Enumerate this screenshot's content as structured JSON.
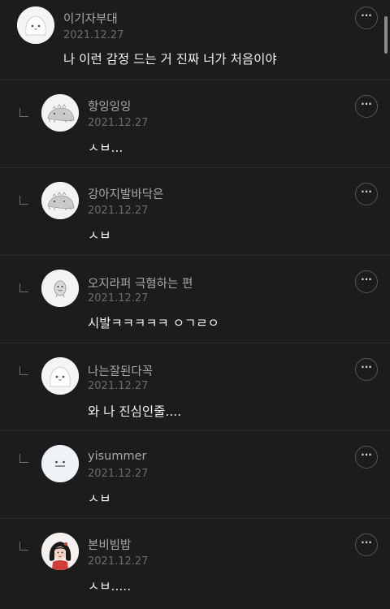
{
  "comments": [
    {
      "author": "이기자부대",
      "date": "2021.12.27",
      "text": "나 이런 감정 드는 거 진짜 너가 처음이야",
      "avatar_icon": "white-blob-character-icon",
      "is_reply": false
    },
    {
      "author": "항잉잉잉",
      "date": "2021.12.27",
      "text": "ㅅㅂ...",
      "avatar_icon": "gray-dinosaur-icon",
      "is_reply": true
    },
    {
      "author": "강아지발바닥은",
      "date": "2021.12.27",
      "text": "ㅅㅂ",
      "avatar_icon": "gray-dinosaur-icon",
      "is_reply": true
    },
    {
      "author": "오지라퍼 극혐하는 편",
      "date": "2021.12.27",
      "text": "시발ㅋㅋㅋㅋㅋ ㅇㄱㄹㅇ",
      "avatar_icon": "small-creature-icon",
      "is_reply": true
    },
    {
      "author": "나는잘된다꼭",
      "date": "2021.12.27",
      "text": "와 나 진심인줄....",
      "avatar_icon": "white-blob-character-icon",
      "is_reply": true
    },
    {
      "author": "yisummer",
      "date": "2021.12.27",
      "text": "ㅅㅂ",
      "avatar_icon": "smiley-face-icon",
      "is_reply": true
    },
    {
      "author": "본비빔밥",
      "date": "2021.12.27",
      "text": "ㅅㅂ.....",
      "avatar_icon": "girl-portrait-icon",
      "is_reply": true
    }
  ],
  "more_button_label": "···",
  "colors": {
    "background": "#1c1c1d",
    "divider": "#2a2a2b",
    "author": "#a8a8ab",
    "date": "#6b6b6e",
    "text": "#f2f2f2"
  }
}
